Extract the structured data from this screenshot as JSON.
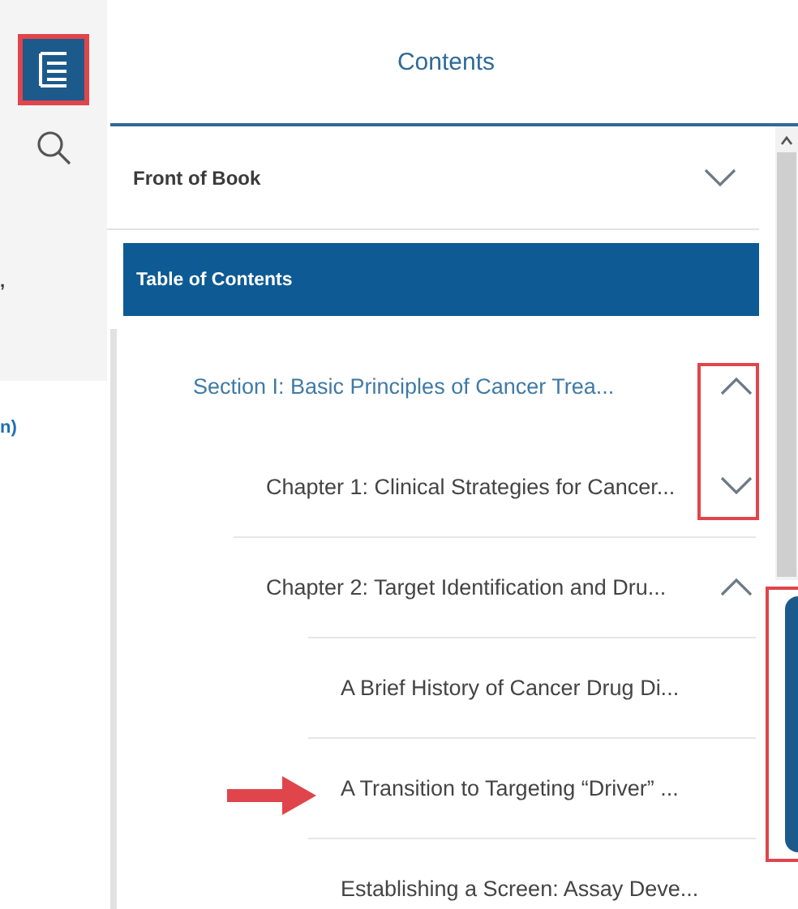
{
  "edge_fragments": [
    ",",
    "n)"
  ],
  "rail": {
    "buttons": [
      {
        "kind": "menu",
        "selected": true
      },
      {
        "kind": "search",
        "selected": false
      }
    ]
  },
  "panel": {
    "title": "Contents",
    "front_of_book": {
      "label": "Front of Book",
      "expanded": false
    },
    "table_of_contents": {
      "label": "Table of Contents",
      "selected": true
    },
    "tree": [
      {
        "label": "Section I: Basic Principles of Cancer Trea...",
        "expanded": true,
        "children": [
          {
            "label": "Chapter 1: Clinical Strategies for Cancer...",
            "expanded": false
          },
          {
            "label": "Chapter 2: Target Identification and Dru...",
            "expanded": true,
            "children": [
              {
                "label": "A Brief History of Cancer Drug Di..."
              },
              {
                "label": "A Transition to Targeting “Driver” ..."
              },
              {
                "label": "Establishing a Screen: Assay Deve..."
              }
            ]
          }
        ]
      }
    ]
  }
}
